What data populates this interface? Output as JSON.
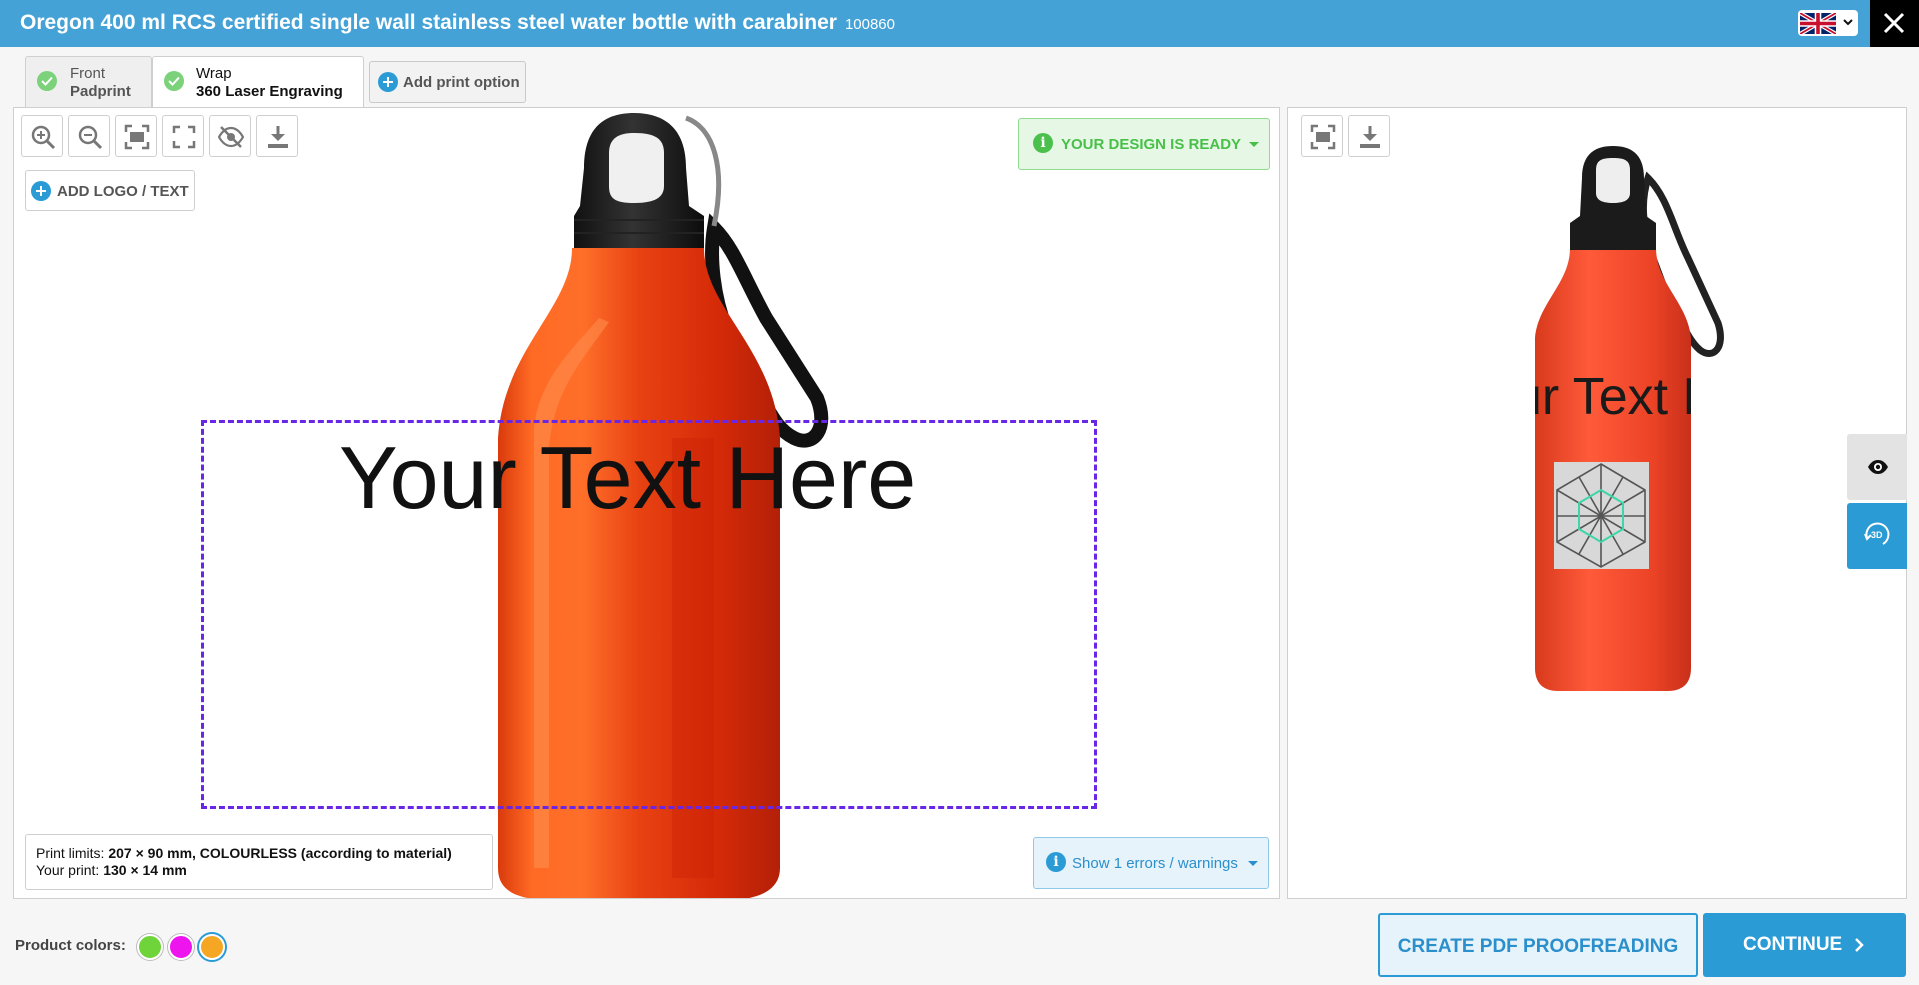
{
  "header": {
    "title": "Oregon 400 ml RCS certified single wall stainless steel water bottle with carabiner",
    "sku": "100860",
    "language_icon": "uk-flag-icon",
    "close_icon": "close-icon",
    "accent_color": "#45a2d6"
  },
  "tabs": [
    {
      "line1": "Front",
      "line2": "Padprint",
      "status_icon": "check-icon",
      "active": false
    },
    {
      "line1": "Wrap",
      "line2": "360 Laser Engraving",
      "status_icon": "check-icon",
      "active": true
    }
  ],
  "add_print_option": {
    "label": "Add print option",
    "icon": "plus-circle-icon"
  },
  "editor": {
    "toolbar": [
      {
        "name": "zoom-in",
        "icon": "zoom-in-icon"
      },
      {
        "name": "zoom-out",
        "icon": "zoom-out-icon"
      },
      {
        "name": "fit-print-area",
        "icon": "fit-area-icon"
      },
      {
        "name": "fullscreen",
        "icon": "fullscreen-icon"
      },
      {
        "name": "toggle-visibility",
        "icon": "eye-slash-icon"
      },
      {
        "name": "download",
        "icon": "download-icon"
      }
    ],
    "add_logo_label": "ADD LOGO / TEXT",
    "design_status": "YOUR DESIGN IS READY",
    "design_text": "Your Text Here",
    "print_limits_label": "Print limits:",
    "print_limits_value": "207 × 90 mm, COLOURLESS (according to material)",
    "your_print_label": "Your print:",
    "your_print_value": "130 × 14 mm",
    "warnings_label": "Show 1 errors / warnings",
    "print_area_color": "#6a26e6"
  },
  "preview": {
    "toolbar": [
      {
        "name": "fit",
        "icon": "fit-area-icon"
      },
      {
        "name": "download",
        "icon": "download-icon"
      }
    ],
    "preview_text": "ur Text He",
    "side_buttons": [
      {
        "name": "view",
        "icon": "eye-icon"
      },
      {
        "name": "3d",
        "icon": "3d-rotate-icon",
        "label": "3D"
      }
    ]
  },
  "footer": {
    "colors_label": "Product colors:",
    "colors": [
      "#6fd43a",
      "#ee14ee",
      "#f5a623"
    ],
    "selected_color_index": 2,
    "pdf_button": "CREATE PDF PROOFREADING",
    "continue_button": "CONTINUE"
  }
}
